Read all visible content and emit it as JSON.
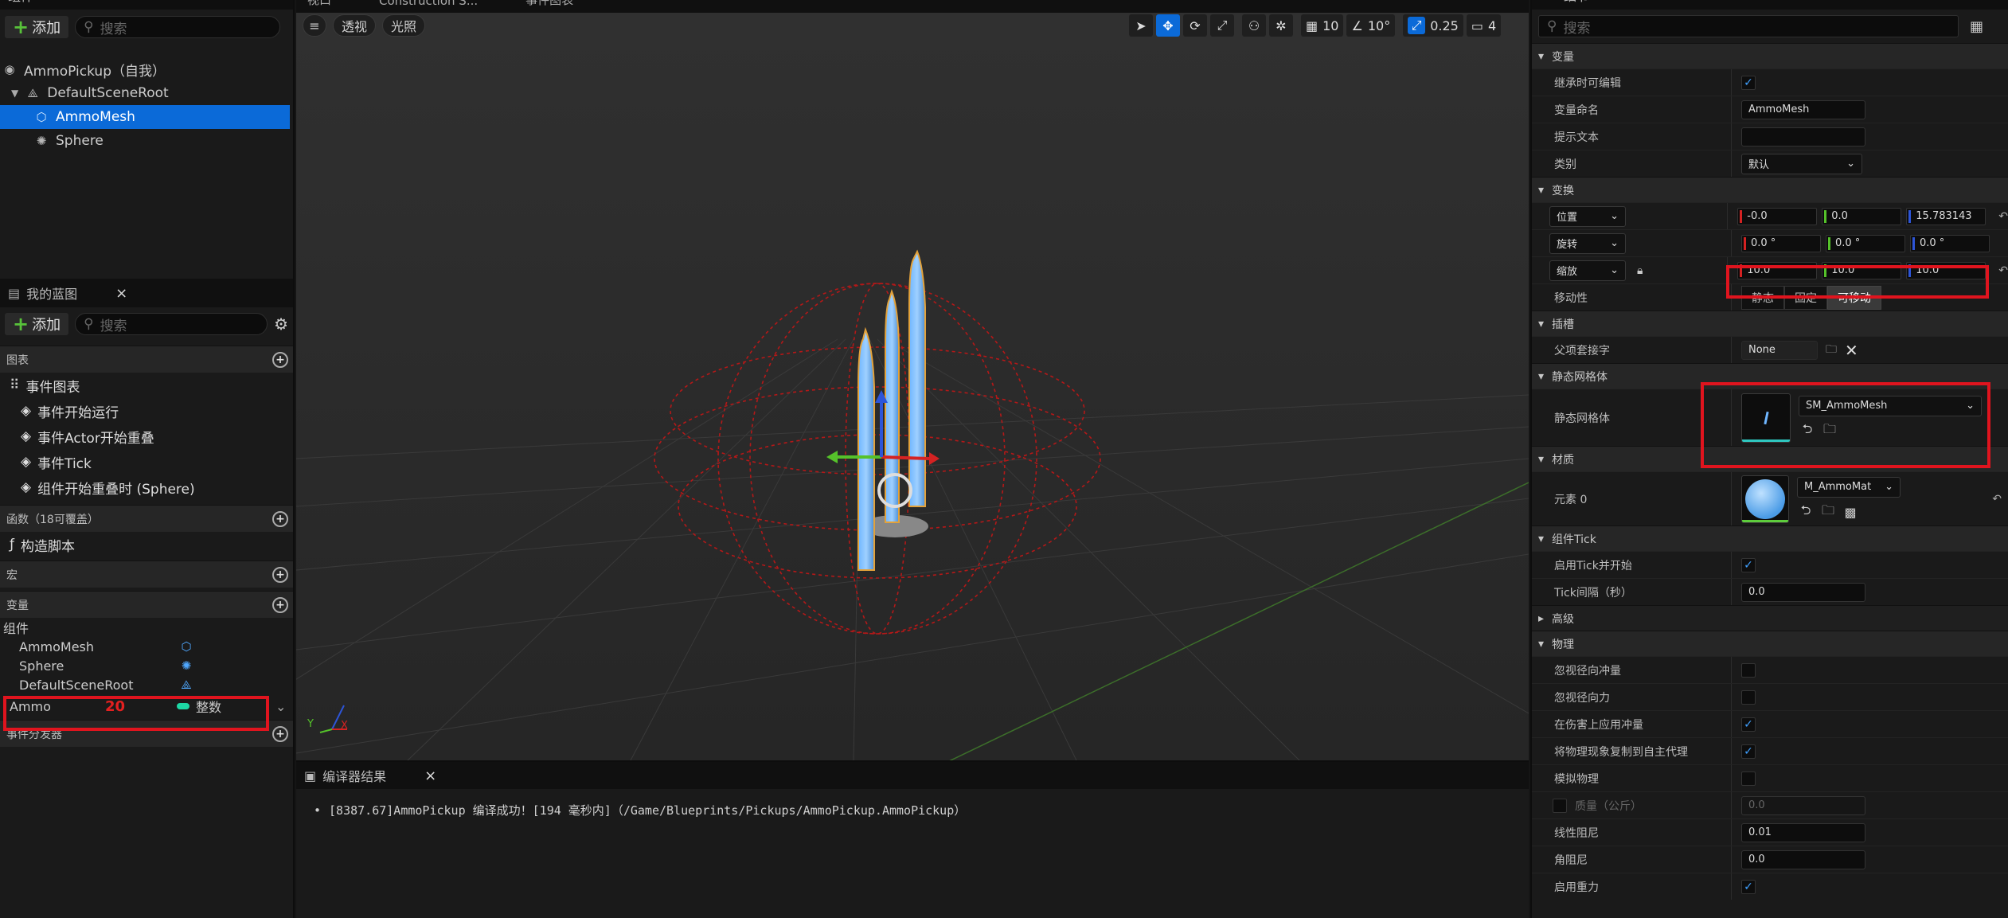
{
  "components": {
    "tab_title": "组件",
    "add_label": "添加",
    "search_placeholder": "搜索",
    "tree": [
      {
        "label": "AmmoPickup（自我）"
      },
      {
        "label": "DefaultSceneRoot"
      },
      {
        "label": "AmmoMesh"
      },
      {
        "label": "Sphere"
      }
    ]
  },
  "my_blueprint": {
    "tab_title": "我的蓝图",
    "add_label": "添加",
    "search_placeholder": "搜索",
    "graphs_header": "图表",
    "event_graph": "事件图表",
    "events": [
      "事件开始运行",
      "事件Actor开始重叠",
      "事件Tick",
      "组件开始重叠时 (Sphere)"
    ],
    "functions_header": "函数（18可覆盖）",
    "construction_script": "构造脚本",
    "macros_header": "宏",
    "variables_header": "变量",
    "components_group": "组件",
    "component_vars": [
      "AmmoMesh",
      "Sphere",
      "DefaultSceneRoot"
    ],
    "ammo_var": {
      "name": "Ammo",
      "type": "整数",
      "annotation": "20"
    },
    "dispatchers_header": "事件分发器"
  },
  "viewport": {
    "tabs": [
      "视口",
      "Construction S...",
      "事件图表"
    ],
    "hamburger": "≡",
    "perspective": "透视",
    "lit": "光照",
    "grid_snap": "10",
    "rot_snap": "10°",
    "scale_snap": "0.25",
    "camera_speed": "4",
    "axis_y": "Y",
    "axis_x": "X"
  },
  "compiler": {
    "tab_title": "编译器结果",
    "message": "[8387.67]AmmoPickup 编译成功！[194 毫秒内]（/Game/Blueprints/Pickups/AmmoPickup.AmmoPickup）"
  },
  "details": {
    "tab_title": "细节",
    "search_placeholder": "搜索",
    "sections": {
      "variable": "变量",
      "transform": "变换",
      "sockets": "插槽",
      "static_mesh": "静态网格体",
      "materials": "材质",
      "component_tick": "组件Tick",
      "advanced": "高级",
      "physics": "物理"
    },
    "variable": {
      "editable_label": "继承时可编辑",
      "name_label": "变量命名",
      "name_value": "AmmoMesh",
      "tooltip_label": "提示文本",
      "tooltip_value": "",
      "category_label": "类别",
      "category_value": "默认"
    },
    "transform": {
      "location_label": "位置",
      "location": [
        "-0.0",
        "0.0",
        "15.783143"
      ],
      "rotation_label": "旋转",
      "rotation": [
        "0.0 °",
        "0.0 °",
        "0.0 °"
      ],
      "scale_label": "缩放",
      "scale": [
        "10.0",
        "10.0",
        "10.0"
      ],
      "mobility_label": "移动性",
      "mobility_options": [
        "静态",
        "固定",
        "可移动"
      ]
    },
    "sockets": {
      "parent_label": "父项套接字",
      "parent_value": "None"
    },
    "static_mesh": {
      "label": "静态网格体",
      "value": "SM_AmmoMesh"
    },
    "materials": {
      "label": "元素 0",
      "value": "M_AmmoMat"
    },
    "tick": {
      "start_label": "启用Tick并开始",
      "interval_label": "Tick间隔（秒）",
      "interval_value": "0.0"
    },
    "physics": {
      "ignore_radial_impulse": "忽视径向冲量",
      "ignore_radial_force": "忽视径向力",
      "apply_impulse_on_damage": "在伤害上应用冲量",
      "replicate_physics": "将物理现象复制到自主代理",
      "simulate_physics": "模拟物理",
      "mass_label": "质量（公斤）",
      "mass_value": "0.0",
      "linear_damping_label": "线性阻尼",
      "linear_damping_value": "0.01",
      "angular_damping_label": "角阻尼",
      "angular_damping_value": "0.0",
      "enable_gravity_label": "启用重力"
    }
  }
}
